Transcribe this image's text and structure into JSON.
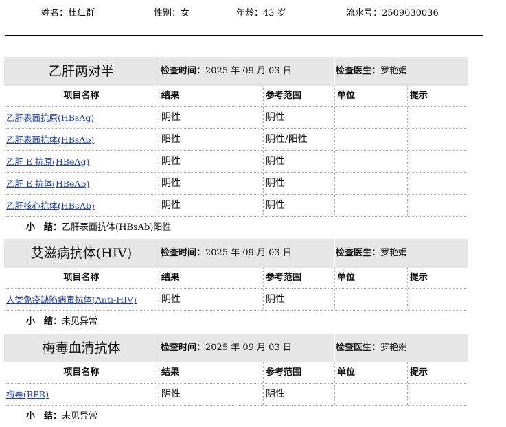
{
  "patient": {
    "name_label": "姓名：",
    "name": "杜仁群",
    "sex_label": "性别：",
    "sex": "女",
    "age_label": "年龄：",
    "age": "43 岁",
    "serial_label": "流水号：",
    "serial": "2509030036"
  },
  "labels": {
    "exam_time": "检查时间：",
    "doctor": "检查医生：",
    "summary": "小　结："
  },
  "columns": [
    "项目名称",
    "结果",
    "参考范围",
    "单位",
    "提示"
  ],
  "sections": [
    {
      "title": "乙肝两对半",
      "exam_time": "2025 年 09 月 03 日",
      "doctor": "罗艳娟",
      "rows": [
        {
          "item": "乙肝表面抗原(HBsAg)",
          "result": "阴性",
          "range": "阴性",
          "unit": "",
          "hint": ""
        },
        {
          "item": "乙肝表面抗体(HBsAb)",
          "result": "阳性",
          "range": "阴性/阳性",
          "unit": "",
          "hint": ""
        },
        {
          "item": "乙肝 E 抗原(HBeAg)",
          "result": "阴性",
          "range": "阴性",
          "unit": "",
          "hint": ""
        },
        {
          "item": "乙肝 E 抗体(HBeAb)",
          "result": "阴性",
          "range": "阴性",
          "unit": "",
          "hint": ""
        },
        {
          "item": "乙肝核心抗体(HBcAb)",
          "result": "阴性",
          "range": "阴性",
          "unit": "",
          "hint": ""
        }
      ],
      "summary": "乙肝表面抗体(HBsAb)阳性"
    },
    {
      "title": "艾滋病抗体(HIV)",
      "exam_time": "2025 年 09 月 03 日",
      "doctor": "罗艳娟",
      "rows": [
        {
          "item": "人类免疫缺陷病毒抗体(Anti-HIV)",
          "result": "阴性",
          "range": "阴性",
          "unit": "",
          "hint": ""
        }
      ],
      "summary": "未见异常"
    },
    {
      "title": "梅毒血清抗体",
      "exam_time": "2025 年 09 月 03 日",
      "doctor": "罗艳娟",
      "rows": [
        {
          "item": "梅毒(RPR)",
          "result": "阴性",
          "range": "阴性",
          "unit": "",
          "hint": ""
        }
      ],
      "summary": "未见异常"
    }
  ]
}
